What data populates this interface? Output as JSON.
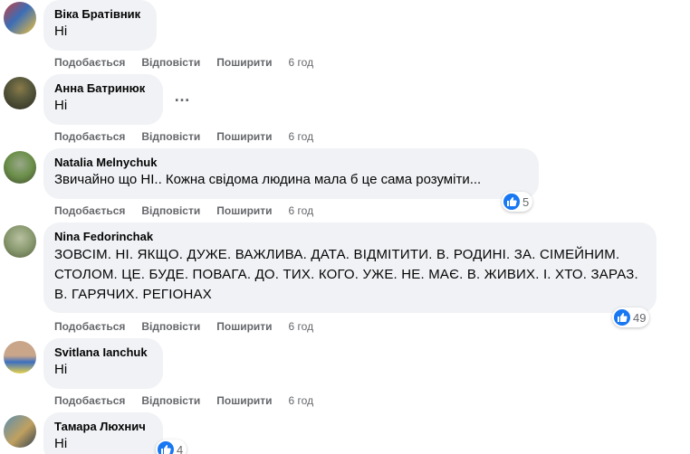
{
  "labels": {
    "like": "Подобається",
    "reply": "Відповісти",
    "share": "Поширити"
  },
  "accent_color": "#1877f2",
  "more_icon": "…",
  "comments": [
    {
      "author": "Віка Братівник",
      "text": "Ні",
      "time": "6 год",
      "reaction_icon": "like-icon",
      "reaction_count": null,
      "avatar_colors": [
        "#c94040",
        "#3b6db6",
        "#f2c13a"
      ]
    },
    {
      "author": "Анна Батринюк",
      "text": "Ні",
      "time": "6 год",
      "reaction_count": null,
      "avatar_colors": [
        "#5a5a3c",
        "#8a7a4a",
        "#2c2c22"
      ]
    },
    {
      "author": "Natalia Melnychuk",
      "text": "Звичайно що НІ.. Кожна свідома людина мала б це сама розуміти...",
      "time": "6 год",
      "reaction_count": "5",
      "avatar_colors": [
        "#6b8f4a",
        "#9aa88a",
        "#404a30"
      ]
    },
    {
      "author": "Nina Fedorinchak",
      "text": "ЗОВСІМ. НІ. ЯКЩО. ДУЖЕ. ВАЖЛИВА. ДАТА. ВІДМІТИТИ. В. РОДИНІ. ЗА. СІМЕЙНИМ. СТОЛОМ. ЦЕ. БУДЕ. ПОВАГА. ДО. ТИХ. КОГО. УЖЕ. НЕ. МАЄ. В. ЖИВИХ. І. ХТО. ЗАРАЗ. В. ГАРЯЧИХ. РЕГІОНАХ",
      "time": "6 год",
      "reaction_count": "49",
      "avatar_colors": [
        "#8a9a70",
        "#b8c0a0",
        "#54603c"
      ]
    },
    {
      "author": "Svitlana Ianchuk",
      "text": "Ні",
      "time": "6 год",
      "reaction_count": null,
      "avatar_colors": [
        "#3d6fc0",
        "#e8d24a",
        "#c9a58a"
      ]
    },
    {
      "author": "Тамара Люхнич",
      "text": "Ні",
      "time": "",
      "reaction_count": "4",
      "avatar_colors": [
        "#5a8fb0",
        "#c0a060",
        "#304050"
      ]
    }
  ]
}
